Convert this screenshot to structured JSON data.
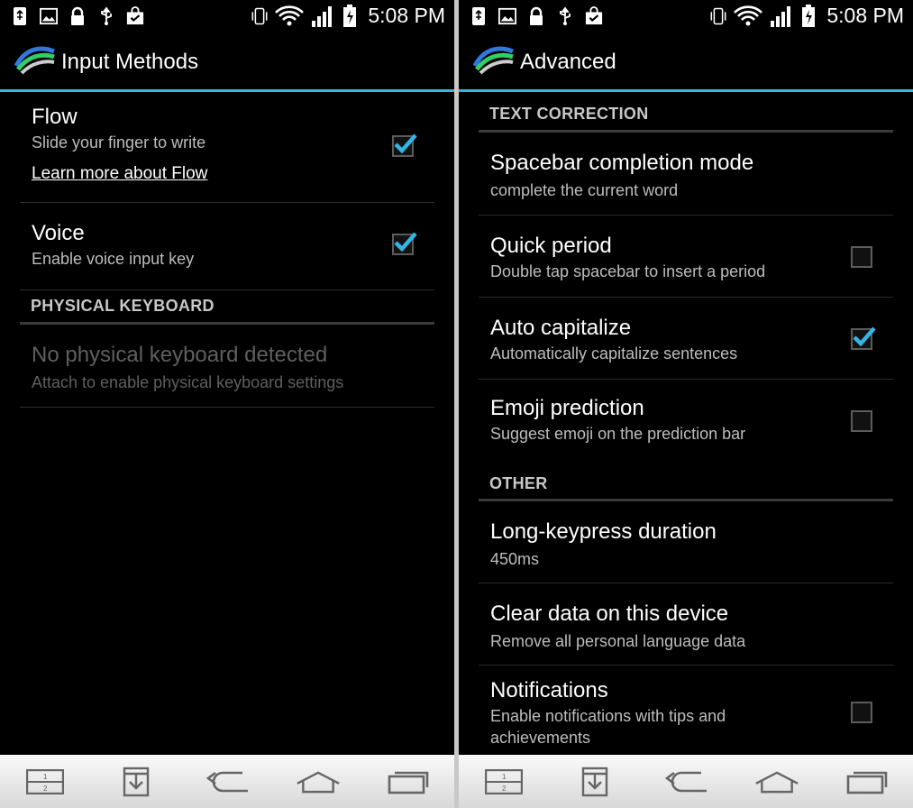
{
  "status": {
    "time": "5:08 PM"
  },
  "left": {
    "title": "Input Methods",
    "flow": {
      "title": "Flow",
      "summary": "Slide your finger to write",
      "link": "Learn more about Flow",
      "checked": true
    },
    "voice": {
      "title": "Voice",
      "summary": "Enable voice input key",
      "checked": true
    },
    "physical_header": "PHYSICAL KEYBOARD",
    "no_keyboard": {
      "title": "No physical keyboard detected",
      "summary": "Attach to enable physical keyboard settings"
    }
  },
  "right": {
    "title": "Advanced",
    "text_correction_header": "TEXT CORRECTION",
    "items": [
      {
        "title": "Spacebar completion mode",
        "summary": "complete the current word"
      },
      {
        "title": "Quick period",
        "summary": "Double tap spacebar to insert a period",
        "checked": false
      },
      {
        "title": "Auto capitalize",
        "summary": "Automatically capitalize sentences",
        "checked": true
      },
      {
        "title": "Emoji prediction",
        "summary": "Suggest emoji on the prediction bar",
        "checked": false
      }
    ],
    "other_header": "OTHER",
    "other_items": [
      {
        "title": "Long-keypress duration",
        "summary": "450ms"
      },
      {
        "title": "Clear data on this device",
        "summary": "Remove all personal language data"
      },
      {
        "title": "Notifications",
        "summary_line1": "Enable notifications with tips and",
        "summary_line2": "achievements",
        "checked": false
      }
    ]
  },
  "icons": {
    "status_left": [
      "usb-notification-icon",
      "image-icon",
      "lock-icon",
      "usb-debug-icon",
      "shopping-bag-icon"
    ],
    "status_right": [
      "vibrate-icon",
      "wifi-icon",
      "signal-icon",
      "battery-charging-icon"
    ],
    "nav": [
      "dual-window-icon",
      "download-icon",
      "back-icon",
      "home-icon",
      "recent-apps-icon"
    ]
  },
  "colors": {
    "accent": "#33b5e5",
    "check": "#33b5e5"
  }
}
